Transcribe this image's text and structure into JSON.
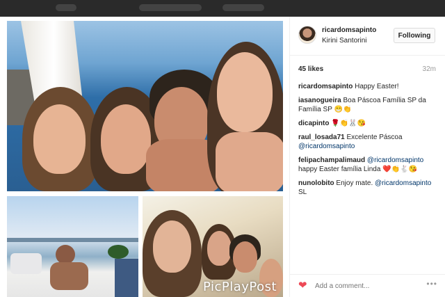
{
  "post": {
    "username": "ricardomsapinto",
    "location": "Kirini Santorini",
    "follow_label": "Following",
    "likes": "45 likes",
    "time": "32m",
    "comments": [
      {
        "user": "ricardomsapinto",
        "text": " Happy Easter!"
      },
      {
        "user": "iasanogueira",
        "text": " Boa Páscoa Família SP da Família SP 😁👏"
      },
      {
        "user": "dicapinto",
        "text": " 🌹👏🐰😘"
      },
      {
        "user": "raul_losada71",
        "text": " Excelente Páscoa ",
        "mention": "@ricardomsapinto"
      },
      {
        "user": "felipachampalimaud",
        "text": " ",
        "mention": "@ricardomsapinto",
        "text2": " happy Easter família Linda ❤️👏🐇😘"
      },
      {
        "user": "nunolobito",
        "text": " Enjoy mate. ",
        "mention": "@ricardomsapinto",
        "text2": " SL"
      }
    ],
    "add_comment_placeholder": "Add a comment...",
    "more_label": "•••",
    "watermark": "PicPlayPost"
  }
}
